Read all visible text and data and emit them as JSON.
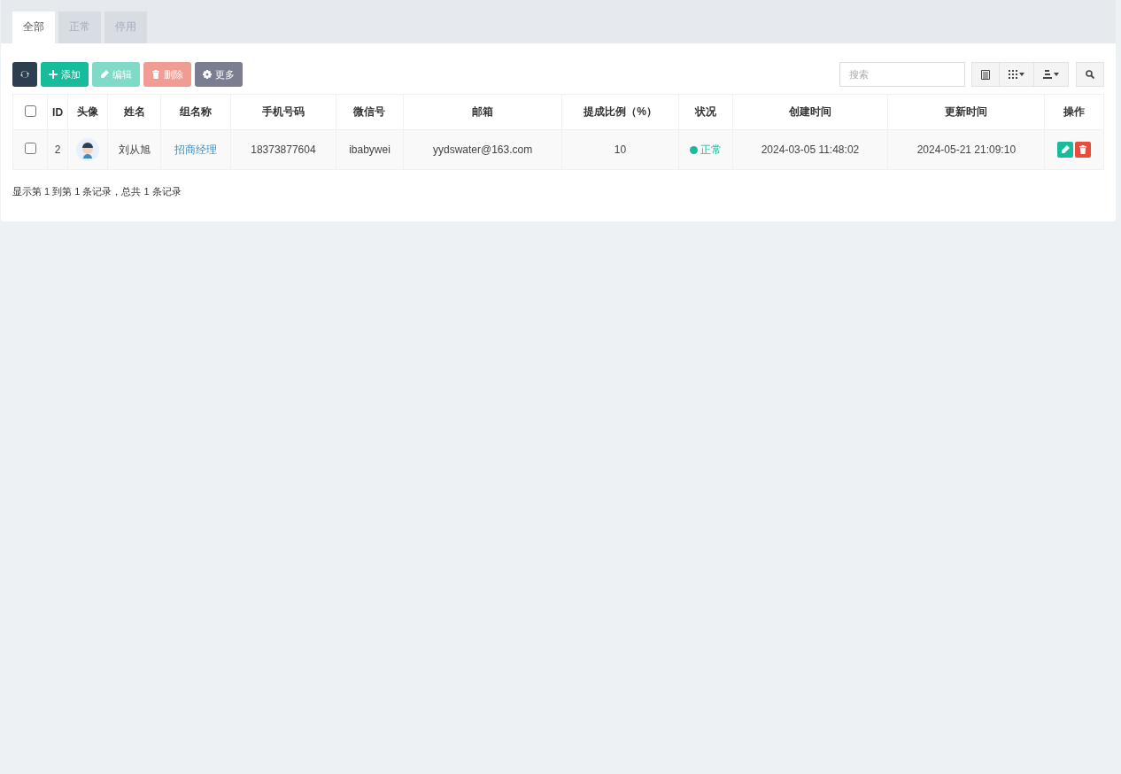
{
  "tabs": [
    {
      "label": "全部",
      "selected": true
    },
    {
      "label": "正常",
      "selected": false
    },
    {
      "label": "停用",
      "selected": false
    }
  ],
  "toolbar": {
    "buttons": [
      {
        "kind": "refresh",
        "disabled": false
      },
      {
        "kind": "add",
        "label": "添加",
        "disabled": false
      },
      {
        "kind": "edit",
        "label": "编辑",
        "disabled": true
      },
      {
        "kind": "delete",
        "label": "删除",
        "disabled": true
      },
      {
        "kind": "more",
        "label": "更多",
        "disabled": false
      }
    ],
    "search": {
      "placeholder": "搜索"
    }
  },
  "table": {
    "select_all_checked": false,
    "columns": [
      "ID",
      "头像",
      "姓名",
      "组名称",
      "手机号码",
      "微信号",
      "邮箱",
      "提成比例（%）",
      "状况",
      "创建时间",
      "更新时间",
      "操作"
    ],
    "rows": [
      {
        "checked": false,
        "id": "2",
        "name": "刘从旭",
        "group": "招商经理",
        "phone": "18373877604",
        "wechat": "ibabywei",
        "email": "yydswater@163.com",
        "commission": "10",
        "status": {
          "label": "正常",
          "color": "#18bc9c"
        },
        "created": "2024-03-05 11:48:02",
        "updated": "2024-05-21 21:09:10"
      }
    ]
  },
  "pagination": {
    "summary": "显示第 1 到第 1 条记录，总共 1 条记录"
  }
}
